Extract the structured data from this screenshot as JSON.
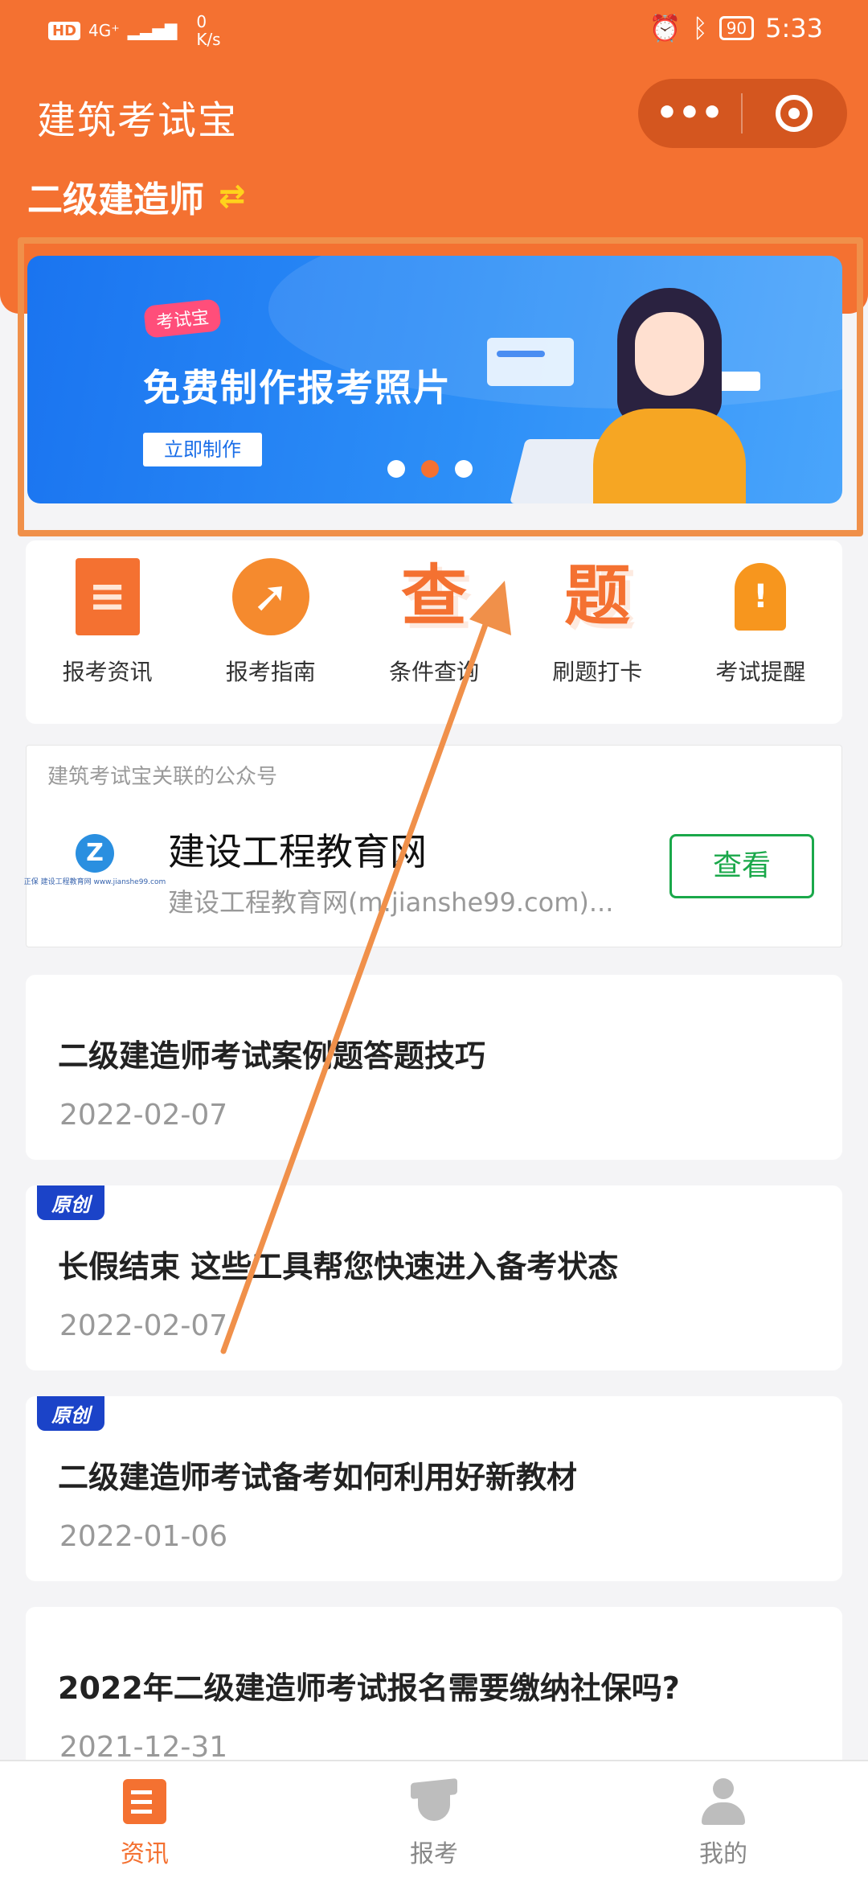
{
  "status_bar": {
    "hd": "HD",
    "network": "4G⁺",
    "speed_value": "0",
    "speed_unit": "K/s",
    "battery": "90",
    "time": "5:33"
  },
  "header": {
    "app_title": "建筑考试宝",
    "capsule_more": "•••",
    "exam_name": "二级建造师",
    "switch_icon": "swap-icon"
  },
  "banner": {
    "tag": "考试宝",
    "headline": "免费制作报考照片",
    "cta": "立即制作",
    "pages": 3,
    "active_page": 2
  },
  "quick_entries": [
    {
      "label": "报考资讯",
      "icon": "news-document-icon",
      "glyph": "≡"
    },
    {
      "label": "报考指南",
      "icon": "compass-icon",
      "glyph": "➚"
    },
    {
      "label": "条件查询",
      "icon": "query-char-icon",
      "glyph": "查"
    },
    {
      "label": "刷题打卡",
      "icon": "question-char-icon",
      "glyph": "题"
    },
    {
      "label": "考试提醒",
      "icon": "bell-icon",
      "glyph": "!"
    }
  ],
  "official_account": {
    "header": "建筑考试宝关联的公众号",
    "logo_text": "正保 建设工程教育网 www.jianshe99.com",
    "name": "建设工程教育网",
    "desc": "建设工程教育网(m.jianshe99.com)...",
    "view_button": "查看"
  },
  "articles": [
    {
      "badge": "",
      "title": "二级建造师考试案例题答题技巧",
      "date": "2022-02-07"
    },
    {
      "badge": "原创",
      "title": "长假结束 这些工具帮您快速进入备考状态",
      "date": "2022-02-07"
    },
    {
      "badge": "原创",
      "title": "二级建造师考试备考如何利用好新教材",
      "date": "2022-01-06"
    },
    {
      "badge": "",
      "title": "2022年二级建造师考试报名需要缴纳社保吗?",
      "date": "2021-12-31"
    }
  ],
  "tabbar": [
    {
      "label": "资讯",
      "icon": "news-tab-icon",
      "active": true
    },
    {
      "label": "报考",
      "icon": "graduation-cap-icon",
      "active": false
    },
    {
      "label": "我的",
      "icon": "user-icon",
      "active": false
    }
  ],
  "colors": {
    "brand": "#f47131",
    "accent_green": "#1aa84a",
    "badge_blue": "#1b43c8",
    "annotation": "#f0904a"
  }
}
